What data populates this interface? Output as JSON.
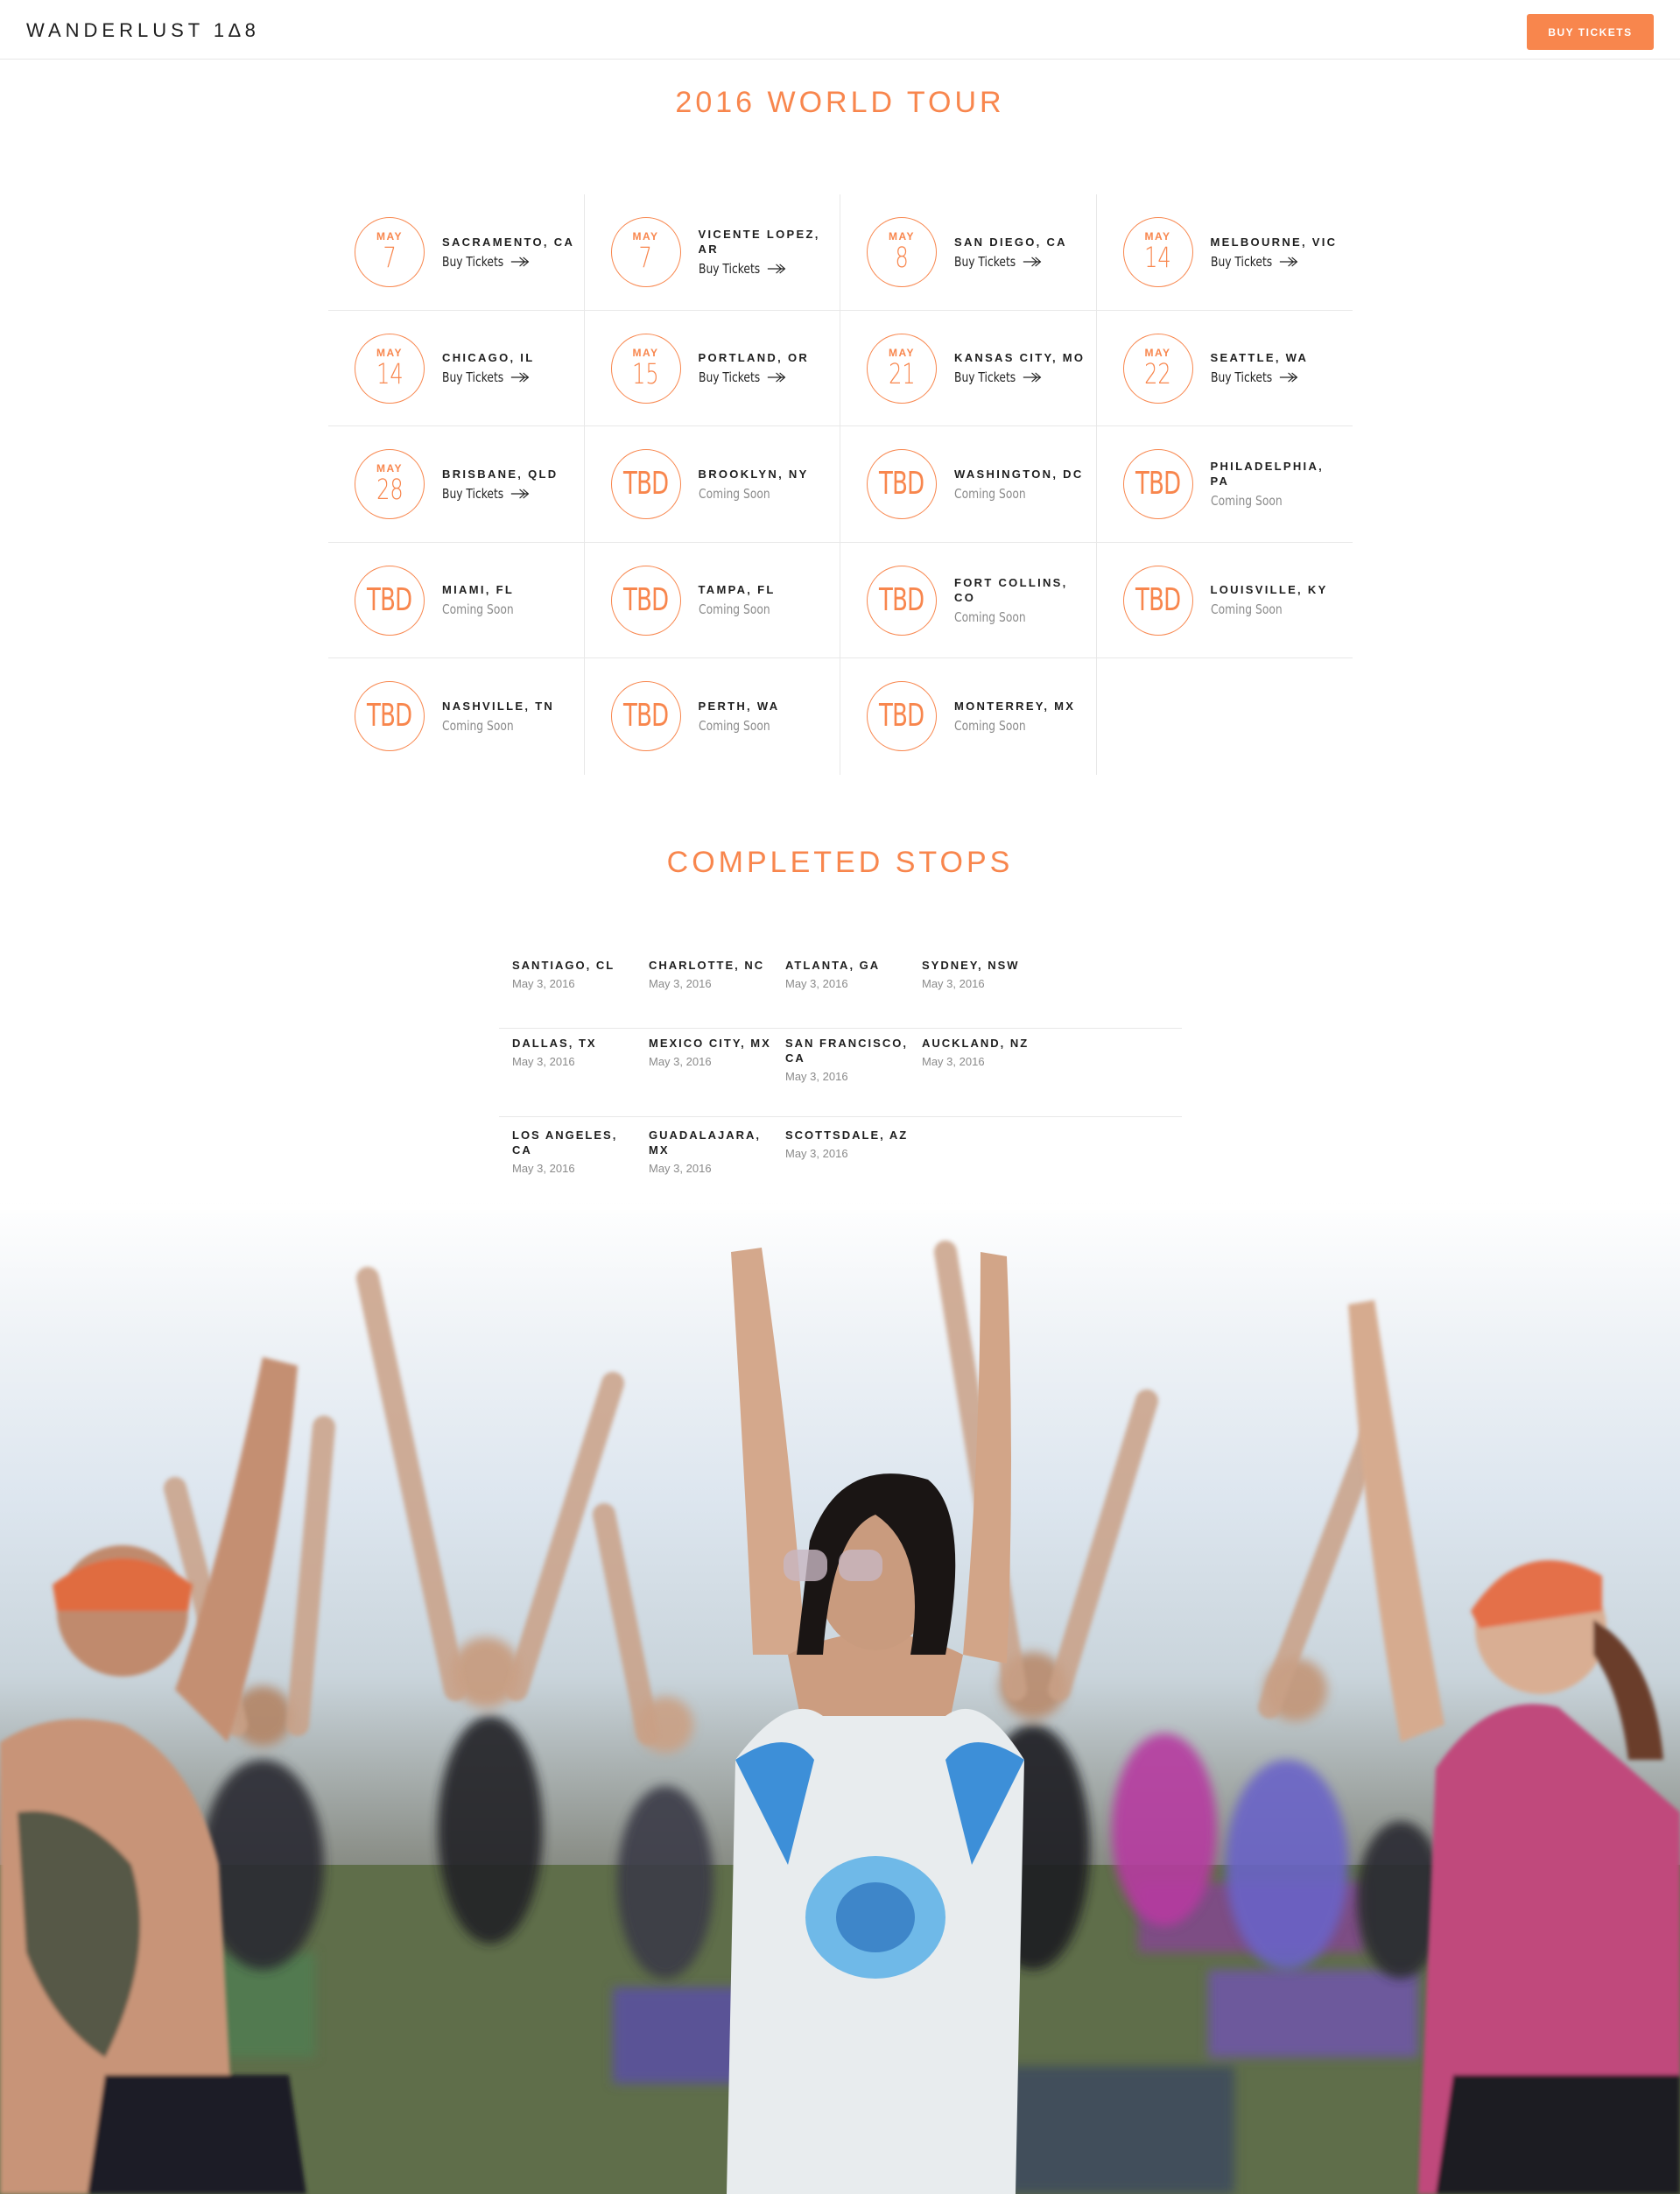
{
  "header": {
    "logo_text": "WANDERLUST 1∆8",
    "buy_button": "BUY TICKETS"
  },
  "tour": {
    "title": "2016 WORLD TOUR",
    "stops": [
      {
        "month": "MAY",
        "day": "7",
        "city": "SACRAMENTO, CA",
        "status": "Buy Tickets"
      },
      {
        "month": "MAY",
        "day": "7",
        "city": "VICENTE LOPEZ, AR",
        "status": "Buy Tickets"
      },
      {
        "month": "MAY",
        "day": "8",
        "city": "SAN DIEGO, CA",
        "status": "Buy Tickets"
      },
      {
        "month": "MAY",
        "day": "14",
        "city": "MELBOURNE, VIC",
        "status": "Buy Tickets"
      },
      {
        "month": "MAY",
        "day": "14",
        "city": "CHICAGO, IL",
        "status": "Buy Tickets"
      },
      {
        "month": "MAY",
        "day": "15",
        "city": "PORTLAND, OR",
        "status": "Buy Tickets"
      },
      {
        "month": "MAY",
        "day": "21",
        "city": "KANSAS CITY, MO",
        "status": "Buy Tickets"
      },
      {
        "month": "MAY",
        "day": "22",
        "city": "SEATTLE, WA",
        "status": "Buy Tickets"
      },
      {
        "month": "MAY",
        "day": "28",
        "city": "BRISBANE, QLD",
        "status": "Buy Tickets"
      },
      {
        "tbd": "TBD",
        "city": "BROOKLYN, NY",
        "status": "Coming Soon"
      },
      {
        "tbd": "TBD",
        "city": "WASHINGTON, DC",
        "status": "Coming Soon"
      },
      {
        "tbd": "TBD",
        "city": "PHILADELPHIA, PA",
        "status": "Coming Soon"
      },
      {
        "tbd": "TBD",
        "city": "MIAMI, FL",
        "status": "Coming Soon"
      },
      {
        "tbd": "TBD",
        "city": "TAMPA, FL",
        "status": "Coming Soon"
      },
      {
        "tbd": "TBD",
        "city": "FORT COLLINS, CO",
        "status": "Coming Soon"
      },
      {
        "tbd": "TBD",
        "city": "LOUISVILLE, KY",
        "status": "Coming Soon"
      },
      {
        "tbd": "TBD",
        "city": "NASHVILLE, TN",
        "status": "Coming Soon"
      },
      {
        "tbd": "TBD",
        "city": "PERTH, WA",
        "status": "Coming Soon"
      },
      {
        "tbd": "TBD",
        "city": "MONTERREY, MX",
        "status": "Coming Soon"
      }
    ]
  },
  "completed": {
    "title": "COMPLETED STOPS",
    "rows": [
      [
        {
          "city": "SANTIAGO, CL",
          "date": "May 3, 2016"
        },
        {
          "city": "CHARLOTTE, NC",
          "date": "May 3, 2016"
        },
        {
          "city": "ATLANTA, GA",
          "date": "May 3, 2016"
        },
        {
          "city": "SYDNEY, NSW",
          "date": "May 3, 2016"
        }
      ],
      [
        {
          "city": "DALLAS, TX",
          "date": "May 3, 2016"
        },
        {
          "city": "MEXICO CITY, MX",
          "date": "May 3, 2016"
        },
        {
          "city": "SAN FRANCISCO, CA",
          "date": "May 3, 2016"
        },
        {
          "city": "AUCKLAND, NZ",
          "date": "May 3, 2016"
        }
      ],
      [
        {
          "city": "LOS ANGELES, CA",
          "date": "May 3, 2016"
        },
        {
          "city": "GUADALAJARA, MX",
          "date": "May 3, 2016"
        },
        {
          "city": "SCOTTSDALE, AZ",
          "date": "May 3, 2016"
        }
      ]
    ]
  },
  "colors": {
    "accent": "#f8864d",
    "text_dark": "#1e1e1e",
    "text_muted": "#8a8a8a"
  },
  "hero_image": {
    "icons": [
      "yoga-crowd-photo"
    ]
  }
}
